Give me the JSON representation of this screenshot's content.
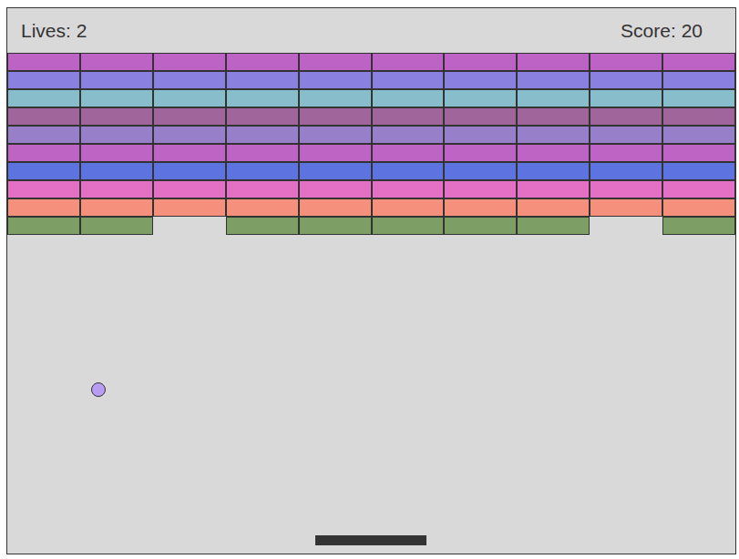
{
  "hud": {
    "lives": "Lives: 2",
    "score": "Score: 20"
  },
  "rows": [
    {
      "color": "#bd63c6",
      "bricks": [
        {
          "broken": false
        },
        {
          "broken": false
        },
        {
          "broken": false
        },
        {
          "broken": false
        },
        {
          "broken": false
        },
        {
          "broken": false
        },
        {
          "broken": false
        },
        {
          "broken": false
        },
        {
          "broken": false
        },
        {
          "broken": false
        }
      ]
    },
    {
      "color": "#8a80e0",
      "bricks": [
        {
          "broken": false
        },
        {
          "broken": false
        },
        {
          "broken": false
        },
        {
          "broken": false
        },
        {
          "broken": false
        },
        {
          "broken": false
        },
        {
          "broken": false
        },
        {
          "broken": false
        },
        {
          "broken": false
        },
        {
          "broken": false
        }
      ]
    },
    {
      "color": "#88bdcc",
      "bricks": [
        {
          "broken": false
        },
        {
          "broken": false
        },
        {
          "broken": false
        },
        {
          "broken": false
        },
        {
          "broken": false
        },
        {
          "broken": false
        },
        {
          "broken": false
        },
        {
          "broken": false
        },
        {
          "broken": false
        },
        {
          "broken": false
        }
      ]
    },
    {
      "color": "#a0659b",
      "bricks": [
        {
          "broken": false
        },
        {
          "broken": false
        },
        {
          "broken": false
        },
        {
          "broken": false
        },
        {
          "broken": false
        },
        {
          "broken": false
        },
        {
          "broken": false
        },
        {
          "broken": false
        },
        {
          "broken": false
        },
        {
          "broken": false
        }
      ]
    },
    {
      "color": "#977fca",
      "bricks": [
        {
          "broken": false
        },
        {
          "broken": false
        },
        {
          "broken": false
        },
        {
          "broken": false
        },
        {
          "broken": false
        },
        {
          "broken": false
        },
        {
          "broken": false
        },
        {
          "broken": false
        },
        {
          "broken": false
        },
        {
          "broken": false
        }
      ]
    },
    {
      "color": "#be64c5",
      "bricks": [
        {
          "broken": false
        },
        {
          "broken": false
        },
        {
          "broken": false
        },
        {
          "broken": false
        },
        {
          "broken": false
        },
        {
          "broken": false
        },
        {
          "broken": false
        },
        {
          "broken": false
        },
        {
          "broken": false
        },
        {
          "broken": false
        }
      ]
    },
    {
      "color": "#5d73df",
      "bricks": [
        {
          "broken": false
        },
        {
          "broken": false
        },
        {
          "broken": false
        },
        {
          "broken": false
        },
        {
          "broken": false
        },
        {
          "broken": false
        },
        {
          "broken": false
        },
        {
          "broken": false
        },
        {
          "broken": false
        },
        {
          "broken": false
        }
      ]
    },
    {
      "color": "#e470c6",
      "bricks": [
        {
          "broken": false
        },
        {
          "broken": false
        },
        {
          "broken": false
        },
        {
          "broken": false
        },
        {
          "broken": false
        },
        {
          "broken": false
        },
        {
          "broken": false
        },
        {
          "broken": false
        },
        {
          "broken": false
        },
        {
          "broken": false
        }
      ]
    },
    {
      "color": "#f4907b",
      "bricks": [
        {
          "broken": false
        },
        {
          "broken": false
        },
        {
          "broken": false
        },
        {
          "broken": false
        },
        {
          "broken": false
        },
        {
          "broken": false
        },
        {
          "broken": false
        },
        {
          "broken": false
        },
        {
          "broken": false
        },
        {
          "broken": false
        }
      ]
    },
    {
      "color": "#7d9e64",
      "bricks": [
        {
          "broken": false
        },
        {
          "broken": false
        },
        {
          "broken": true
        },
        {
          "broken": false
        },
        {
          "broken": false
        },
        {
          "broken": false
        },
        {
          "broken": false
        },
        {
          "broken": false
        },
        {
          "broken": true
        },
        {
          "broken": false
        }
      ]
    }
  ]
}
